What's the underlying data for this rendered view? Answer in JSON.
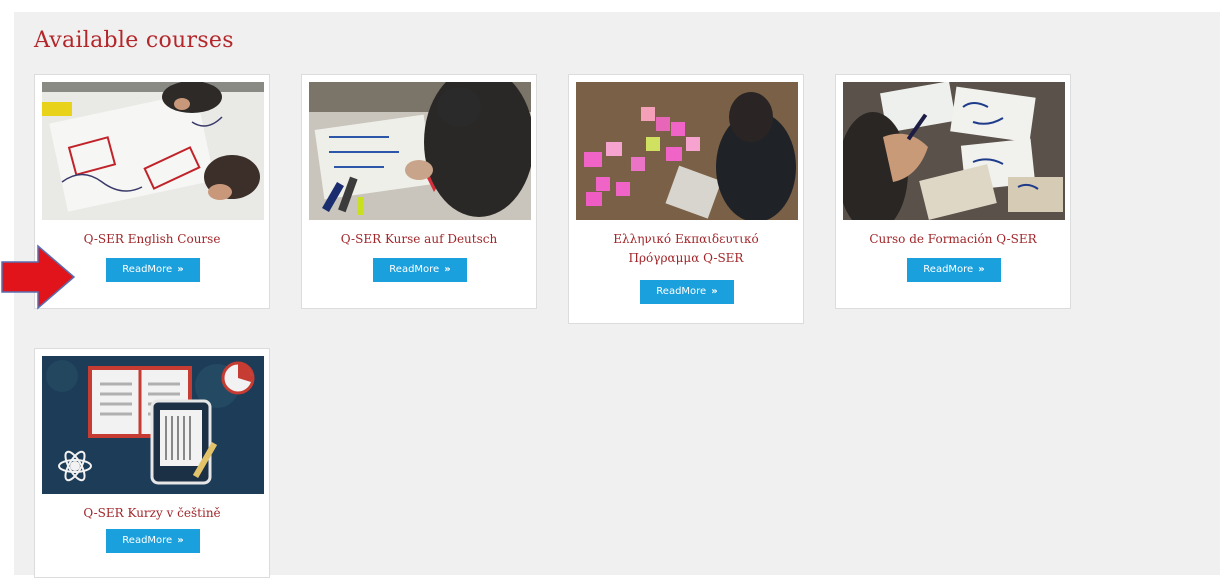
{
  "page": {
    "heading": "Available courses"
  },
  "courses": [
    {
      "title": "Q-SER English Course",
      "button": "ReadMore",
      "arrow": "»"
    },
    {
      "title": "Q-SER Kurse auf Deutsch",
      "button": "ReadMore",
      "arrow": "»"
    },
    {
      "title_line1": "Ελληνικό Εκπαιδευτικό",
      "title_line2": "Πρόγραμμα Q-SER",
      "button": "ReadMore",
      "arrow": "»"
    },
    {
      "title": "Curso de Formación Q-SER",
      "button": "ReadMore",
      "arrow": "»"
    },
    {
      "title": "Q-SER Kurzy v češtině",
      "button": "ReadMore",
      "arrow": "»"
    }
  ],
  "colors": {
    "accent": "#b3262a",
    "button": "#1aa0dc",
    "pointer_arrow": "#e1141b"
  },
  "icons": {
    "pointer": "red-arrow-icon",
    "button_arrow": "double-chevron-right-icon"
  }
}
